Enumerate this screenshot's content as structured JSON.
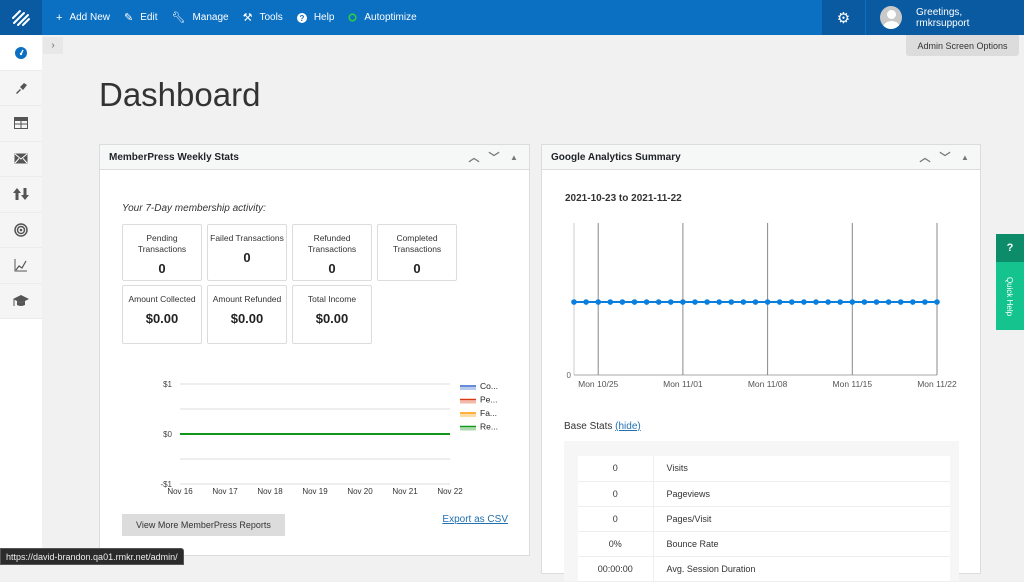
{
  "topbar": {
    "items": [
      {
        "icon": "plus-icon",
        "label": "Add New"
      },
      {
        "icon": "pencil-icon",
        "label": "Edit"
      },
      {
        "icon": "wrench-icon",
        "label": "Manage"
      },
      {
        "icon": "tools-icon",
        "label": "Tools"
      },
      {
        "icon": "help-icon",
        "label": "Help"
      },
      {
        "icon": "status-circle-icon",
        "label": "Autoptimize",
        "status_color": "#2ecc40"
      }
    ],
    "greeting": "Greetings, rmkrsupport",
    "screen_options": "Admin Screen Options"
  },
  "sidebar": {
    "items": [
      {
        "icon": "dashboard-icon",
        "active": true
      },
      {
        "icon": "brush-icon"
      },
      {
        "icon": "table-icon"
      },
      {
        "icon": "mail-icon"
      },
      {
        "icon": "arrows-updown-icon"
      },
      {
        "icon": "target-icon"
      },
      {
        "icon": "chart-line-icon"
      },
      {
        "icon": "graduation-cap-icon"
      }
    ],
    "expand_glyph": "›"
  },
  "page": {
    "title": "Dashboard"
  },
  "memberpress": {
    "title": "MemberPress Weekly Stats",
    "activity_label": "Your 7-Day membership activity:",
    "cards": [
      {
        "label": "Pending Transactions",
        "value": "0"
      },
      {
        "label": "Failed Transactions",
        "value": "0"
      },
      {
        "label": "Refunded Transactions",
        "value": "0"
      },
      {
        "label": "Completed Transactions",
        "value": "0"
      },
      {
        "label": "Amount Collected",
        "value": "$0.00"
      },
      {
        "label": "Amount Refunded",
        "value": "$0.00"
      },
      {
        "label": "Total Income",
        "value": "$0.00"
      }
    ],
    "view_more": "View More MemberPress Reports",
    "export": "Export as CSV"
  },
  "analytics": {
    "title": "Google Analytics Summary",
    "range": "2021-10-23 to 2021-11-22",
    "base_stats_label": "Base Stats",
    "hide_link": "(hide)",
    "stats": [
      {
        "value": "0",
        "label": "Visits"
      },
      {
        "value": "0",
        "label": "Pageviews"
      },
      {
        "value": "0",
        "label": "Pages/Visit"
      },
      {
        "value": "0%",
        "label": "Bounce Rate"
      },
      {
        "value": "00:00:00",
        "label": "Avg. Session Duration"
      }
    ]
  },
  "quick_help": {
    "icon": "?",
    "label": "Quick Help"
  },
  "status_url": "https://david-brandon.qa01.rmkr.net/admin/",
  "chart_data": [
    {
      "type": "line",
      "title": "",
      "categories": [
        "Nov 16",
        "Nov 17",
        "Nov 18",
        "Nov 19",
        "Nov 20",
        "Nov 21",
        "Nov 22"
      ],
      "yticks": [
        "$1",
        "$0",
        "-$1"
      ],
      "ylim": [
        -1,
        1
      ],
      "grid": true,
      "legend": "right",
      "series": [
        {
          "name": "Co...",
          "color": "#3366cc",
          "values": [
            0,
            0,
            0,
            0,
            0,
            0,
            0
          ]
        },
        {
          "name": "Pe...",
          "color": "#dc3912",
          "values": [
            0,
            0,
            0,
            0,
            0,
            0,
            0
          ]
        },
        {
          "name": "Fa...",
          "color": "#ff9900",
          "values": [
            0,
            0,
            0,
            0,
            0,
            0,
            0
          ]
        },
        {
          "name": "Re...",
          "color": "#109618",
          "values": [
            0,
            0,
            0,
            0,
            0,
            0,
            0
          ]
        }
      ]
    },
    {
      "type": "line",
      "title": "2021-10-23 to 2021-11-22",
      "xticks": [
        "Mon 10/25",
        "Mon 11/01",
        "Mon 11/08",
        "Mon 11/15",
        "Mon 11/22"
      ],
      "ytick_min": "0",
      "series": [
        {
          "name": "Visits",
          "color": "#0a7fde",
          "points": 31,
          "values": [
            0,
            0,
            0,
            0,
            0,
            0,
            0,
            0,
            0,
            0,
            0,
            0,
            0,
            0,
            0,
            0,
            0,
            0,
            0,
            0,
            0,
            0,
            0,
            0,
            0,
            0,
            0,
            0,
            0,
            0,
            0
          ]
        }
      ]
    }
  ]
}
